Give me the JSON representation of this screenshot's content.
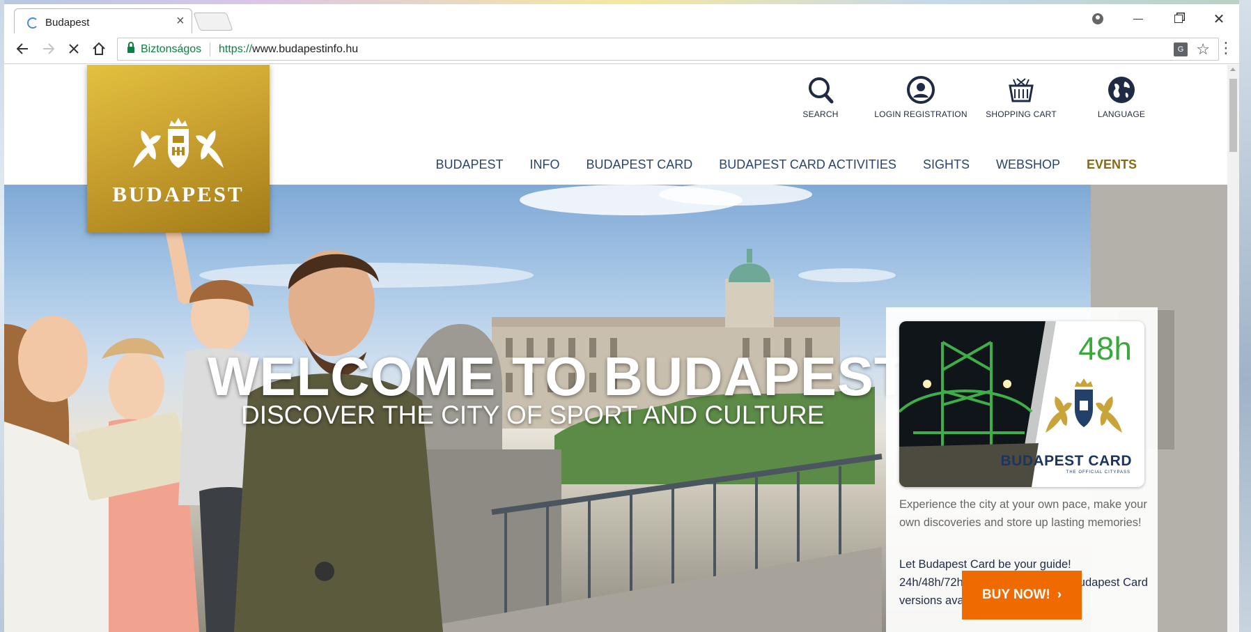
{
  "browser": {
    "tab_title": "Budapest",
    "tab_close": "×",
    "secure_label": "Biztonságos",
    "url_protocol": "https://",
    "url_host": "www.budapestinfo.hu",
    "win_close": "✕"
  },
  "site": {
    "logo_text": "BUDAPEST",
    "utility_nav": [
      {
        "label": "SEARCH",
        "icon": "search-icon"
      },
      {
        "label": "LOGIN REGISTRATION",
        "icon": "user-icon"
      },
      {
        "label": "SHOPPING CART",
        "icon": "basket-icon"
      },
      {
        "label": "LANGUAGE",
        "icon": "globe-icon"
      }
    ],
    "main_nav": [
      {
        "label": "BUDAPEST"
      },
      {
        "label": "INFO"
      },
      {
        "label": "BUDAPEST CARD"
      },
      {
        "label": "BUDAPEST CARD ACTIVITIES"
      },
      {
        "label": "SIGHTS"
      },
      {
        "label": "WEBSHOP"
      },
      {
        "label": "EVENTS",
        "active": true
      }
    ],
    "hero": {
      "headline": "WELCOME TO BUDAPEST,",
      "subheadline": "DISCOVER THE CITY OF SPORT AND CULTURE"
    },
    "promo": {
      "card_hours": "48h",
      "card_name": "BUDAPEST CARD",
      "card_tagline": "THE OFFICIAL CITYPASS",
      "text1": "Experience the city at your own pace, make your own discoveries and store up lasting memories!",
      "text2": "Let Budapest Card be your guide! 24h/48h/72h/72h junior/96h/120h Budapest Card versions available.",
      "button_label": "BUY NOW!",
      "button_arrow": "›"
    }
  },
  "colors": {
    "accent_gold": "#b8921f",
    "nav_blue": "#27456e",
    "events_gold": "#8a6a10",
    "buy_orange": "#ef6a00",
    "card_green": "#39a93b",
    "secure_green": "#0b8043"
  }
}
